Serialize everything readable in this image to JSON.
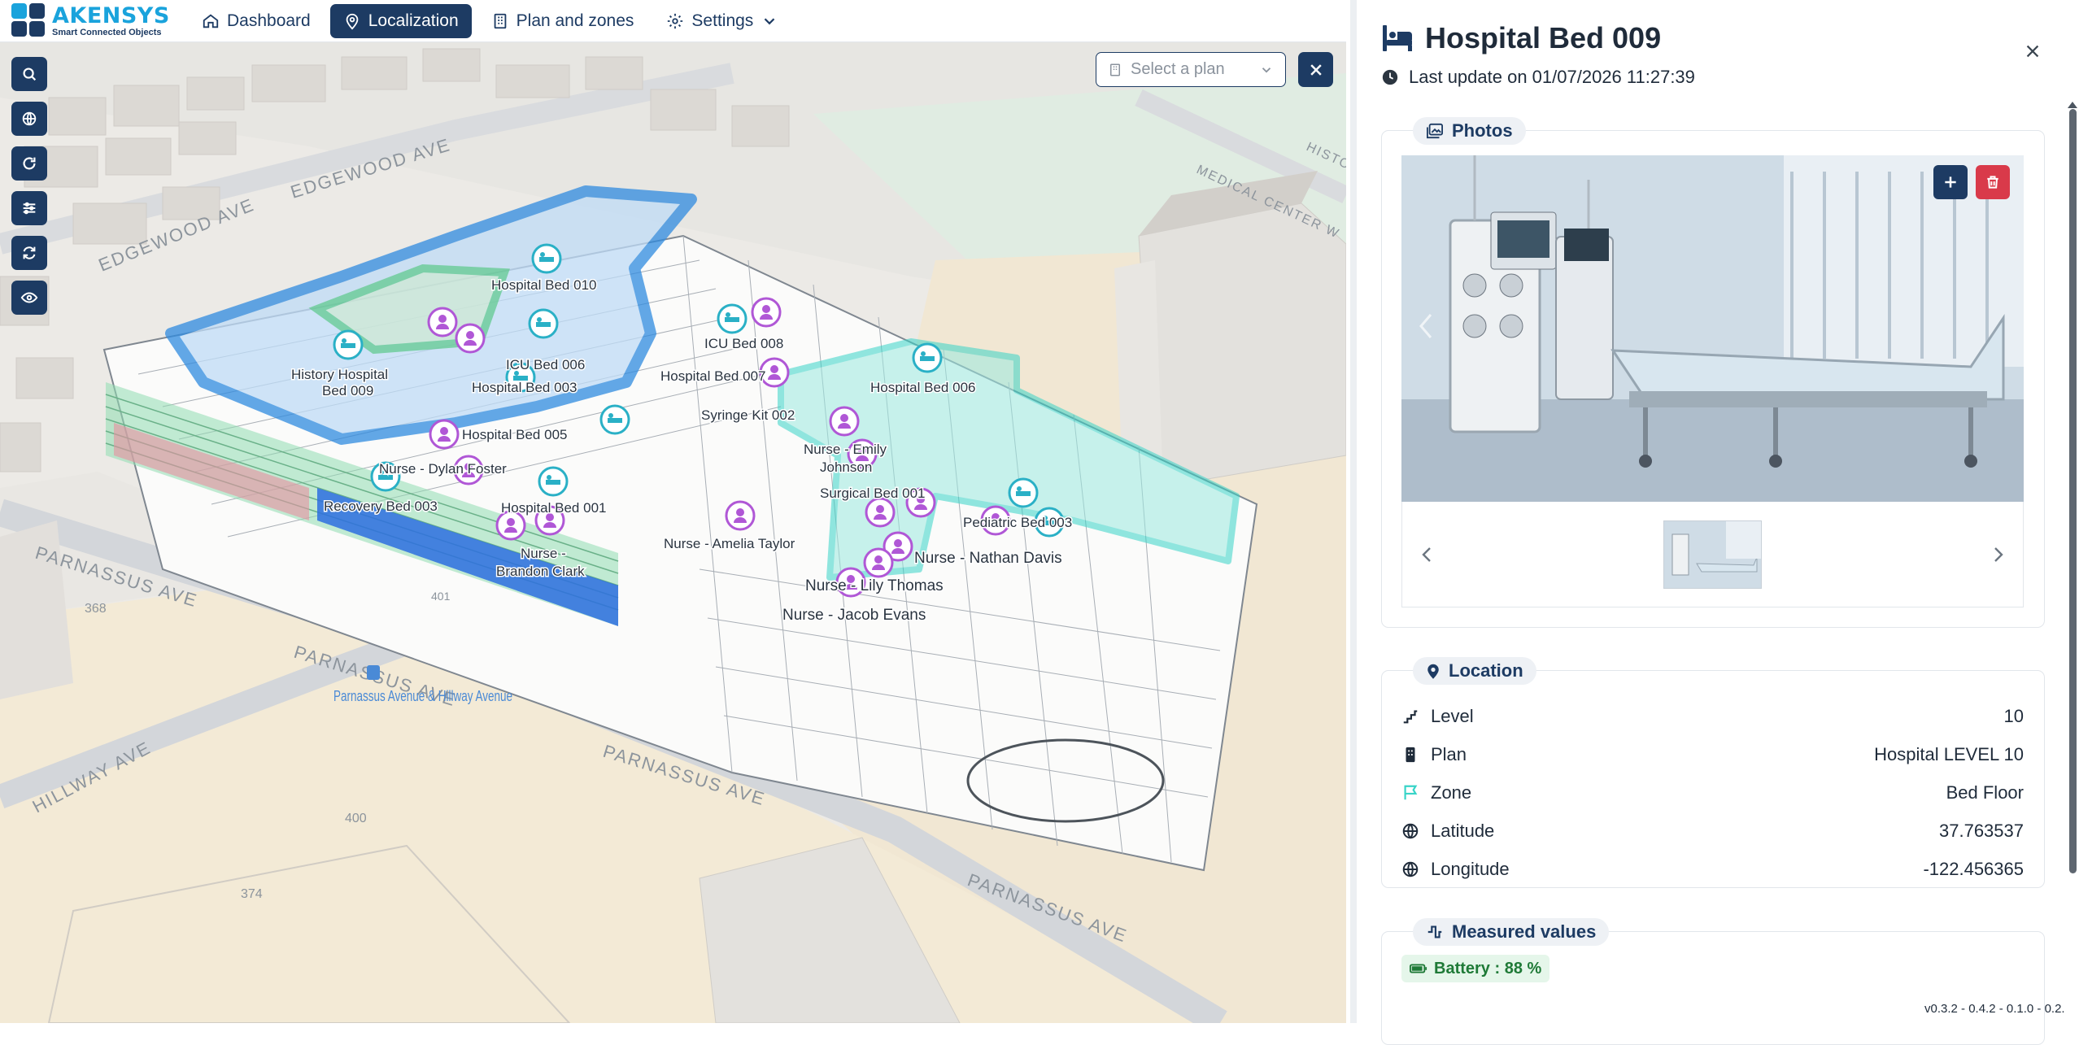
{
  "logo": {
    "name": "AKENSYS",
    "tagline": "Smart Connected Objects"
  },
  "nav": {
    "dashboard": "Dashboard",
    "localization": "Localization",
    "plan_and_zones": "Plan and zones",
    "settings": "Settings"
  },
  "map": {
    "select_plan_placeholder": "Select a plan",
    "streets": [
      "EDGEWOOD AVE",
      "EDGEWOOD AVE",
      "PARNASSUS AVE",
      "PARNASSUS AVE",
      "PARNASSUS AVE",
      "PARNASSUS AVE",
      "HILLWAY AVE",
      "MEDICAL CENTER W",
      "HISTO"
    ],
    "stop": "Parnassus Avenue & Hillway Avenue",
    "numbers": [
      "368",
      "400",
      "374",
      "401"
    ],
    "markers": [
      "Hospital Bed 010",
      "History Hospital",
      "Bed 009",
      "ICU Bed 006",
      "Hospital Bed 003",
      "Hospital Bed 005",
      "Nurse - Dylan Foster",
      "Recovery Bed 003",
      "Hospital Bed 001",
      "Nurse -",
      "Brandon Clark",
      "ICU Bed 008",
      "Hospital Bed 007",
      "Syringe Kit 002",
      "Hospital Bed 006",
      "Nurse - Emily",
      "Johnson",
      "Surgical Bed 001",
      "Nurse - Amelia Taylor",
      "Pediatric Bed 003",
      "Nurse - Nathan Davis",
      "Nurse - Lily Thomas",
      "Nurse - Jacob Evans"
    ]
  },
  "panel": {
    "title": "Hospital Bed 009",
    "last_update": "Last update on 01/07/2026 11:27:39",
    "photos_label": "Photos",
    "location_label": "Location",
    "location": [
      {
        "icon": "stairs-icon",
        "label": "Level",
        "value": "10"
      },
      {
        "icon": "building-icon",
        "label": "Plan",
        "value": "Hospital LEVEL 10"
      },
      {
        "icon": "flag-icon",
        "label": "Zone",
        "value": "Bed Floor"
      },
      {
        "icon": "globe-icon",
        "label": "Latitude",
        "value": "37.763537"
      },
      {
        "icon": "globe-icon",
        "label": "Longitude",
        "value": "-122.456365"
      }
    ],
    "measured_label": "Measured values",
    "battery": "Battery : 88 %"
  },
  "version": "v0.3.2 - 0.4.2 - 0.1.0 - 0.2.",
  "colors": {
    "brand_dark": "#1d3b63",
    "brand_light": "#1aa3dc",
    "zone_blue": "#2f8be0",
    "zone_green": "#5cc98a",
    "zone_teal": "#38d4c8",
    "person": "#b057d6"
  }
}
